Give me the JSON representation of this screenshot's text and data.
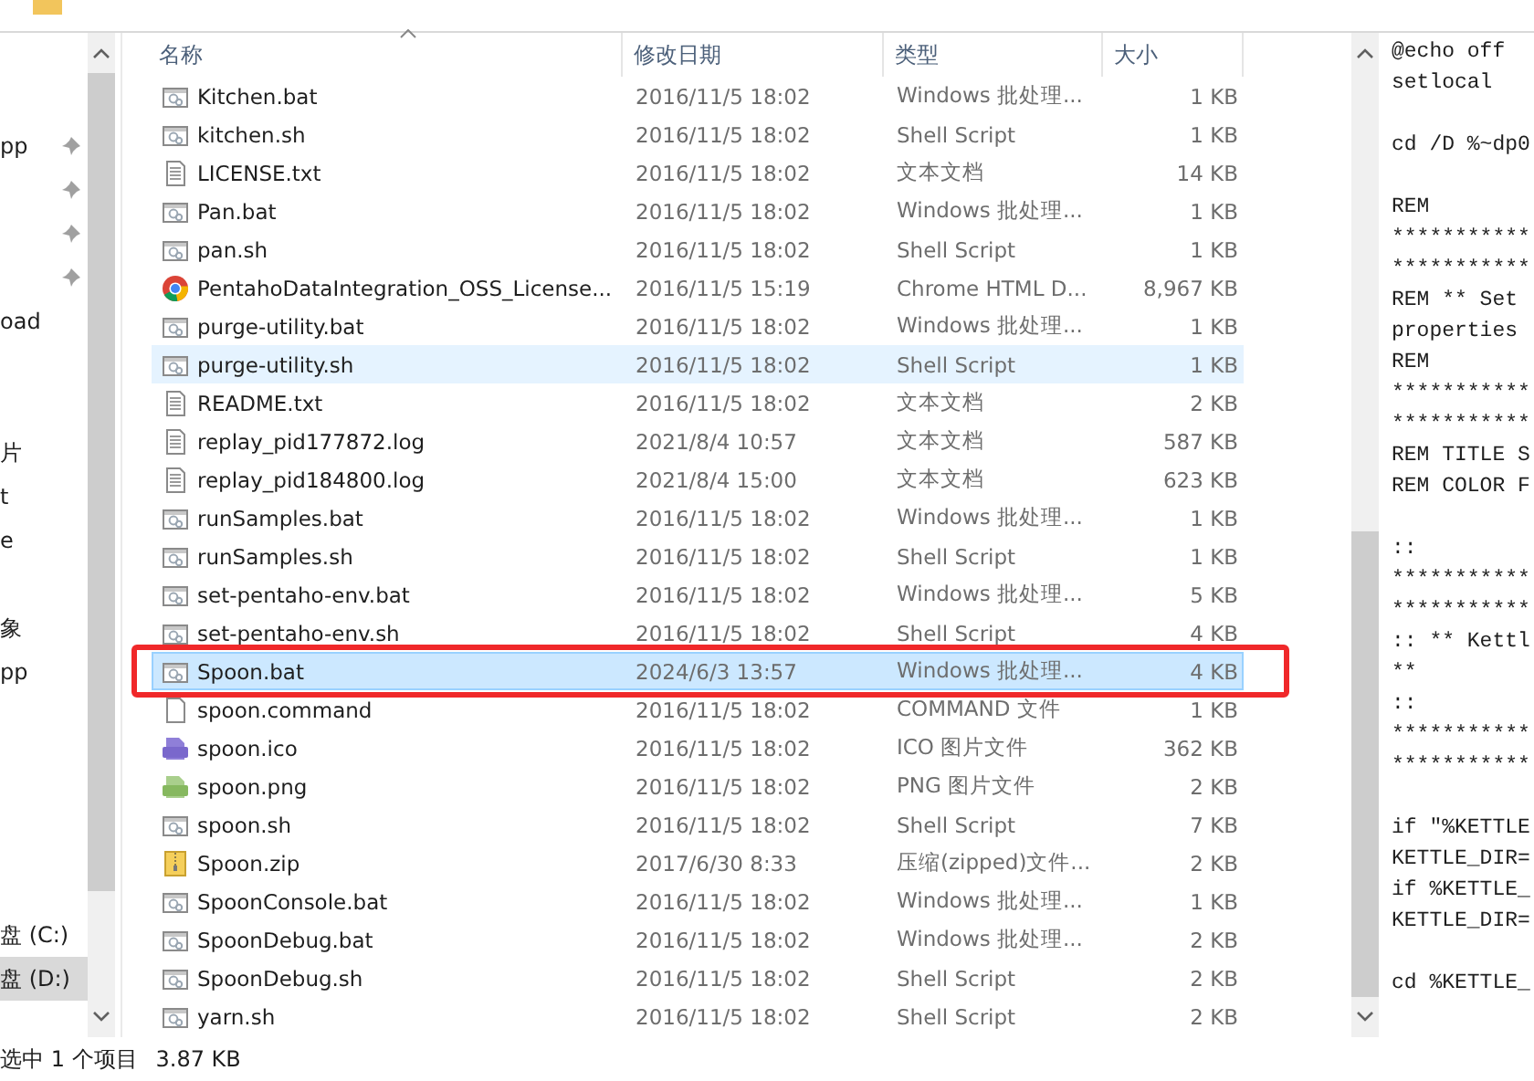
{
  "navigation": {
    "groups": [
      [
        {
          "label": "pp",
          "pinned": true,
          "selected": false
        },
        {
          "pinned": true,
          "selected": false
        },
        {
          "pinned": true,
          "selected": false
        },
        {
          "pinned": true,
          "selected": false
        },
        {
          "label": "oad",
          "pinned": false,
          "selected": false
        }
      ],
      [
        {
          "label": "片",
          "pinned": false,
          "selected": false
        },
        {
          "label": "t",
          "pinned": false,
          "selected": false
        },
        {
          "label": "e",
          "pinned": false,
          "selected": false
        }
      ],
      [
        {
          "label": "象",
          "pinned": false,
          "selected": false
        },
        {
          "label": "pp",
          "pinned": false,
          "selected": false
        }
      ],
      [
        {
          "label": "盘 (C:)",
          "pinned": false,
          "selected": false
        },
        {
          "label": "盘 (D:)",
          "pinned": false,
          "selected": true
        }
      ]
    ]
  },
  "file_list": {
    "columns": [
      "名称",
      "修改日期",
      "类型",
      "大小"
    ],
    "rows": [
      {
        "kind": "script",
        "name": "Kitchen.bat",
        "date": "2016/11/5 18:02",
        "type": "Windows 批处理...",
        "size": "1 KB",
        "selected": false,
        "hovered": false,
        "marked": false
      },
      {
        "kind": "script",
        "name": "kitchen.sh",
        "date": "2016/11/5 18:02",
        "type": "Shell Script",
        "size": "1 KB",
        "selected": false,
        "hovered": false,
        "marked": false
      },
      {
        "kind": "text",
        "name": "LICENSE.txt",
        "date": "2016/11/5 18:02",
        "type": "文本文档",
        "size": "14 KB",
        "selected": false,
        "hovered": false,
        "marked": false
      },
      {
        "kind": "script",
        "name": "Pan.bat",
        "date": "2016/11/5 18:02",
        "type": "Windows 批处理...",
        "size": "1 KB",
        "selected": false,
        "hovered": false,
        "marked": false
      },
      {
        "kind": "script",
        "name": "pan.sh",
        "date": "2016/11/5 18:02",
        "type": "Shell Script",
        "size": "1 KB",
        "selected": false,
        "hovered": false,
        "marked": false
      },
      {
        "kind": "chrome",
        "name": "PentahoDataIntegration_OSS_License...",
        "date": "2016/11/5 15:19",
        "type": "Chrome HTML D...",
        "size": "8,967 KB",
        "selected": false,
        "hovered": false,
        "marked": false
      },
      {
        "kind": "script",
        "name": "purge-utility.bat",
        "date": "2016/11/5 18:02",
        "type": "Windows 批处理...",
        "size": "1 KB",
        "selected": false,
        "hovered": false,
        "marked": false
      },
      {
        "kind": "script",
        "name": "purge-utility.sh",
        "date": "2016/11/5 18:02",
        "type": "Shell Script",
        "size": "1 KB",
        "selected": false,
        "hovered": true,
        "marked": false
      },
      {
        "kind": "text",
        "name": "README.txt",
        "date": "2016/11/5 18:02",
        "type": "文本文档",
        "size": "2 KB",
        "selected": false,
        "hovered": false,
        "marked": false
      },
      {
        "kind": "text",
        "name": "replay_pid177872.log",
        "date": "2021/8/4 10:57",
        "type": "文本文档",
        "size": "587 KB",
        "selected": false,
        "hovered": false,
        "marked": false
      },
      {
        "kind": "text",
        "name": "replay_pid184800.log",
        "date": "2021/8/4 15:00",
        "type": "文本文档",
        "size": "623 KB",
        "selected": false,
        "hovered": false,
        "marked": false
      },
      {
        "kind": "script",
        "name": "runSamples.bat",
        "date": "2016/11/5 18:02",
        "type": "Windows 批处理...",
        "size": "1 KB",
        "selected": false,
        "hovered": false,
        "marked": false
      },
      {
        "kind": "script",
        "name": "runSamples.sh",
        "date": "2016/11/5 18:02",
        "type": "Shell Script",
        "size": "1 KB",
        "selected": false,
        "hovered": false,
        "marked": false
      },
      {
        "kind": "script",
        "name": "set-pentaho-env.bat",
        "date": "2016/11/5 18:02",
        "type": "Windows 批处理...",
        "size": "5 KB",
        "selected": false,
        "hovered": false,
        "marked": false
      },
      {
        "kind": "script",
        "name": "set-pentaho-env.sh",
        "date": "2016/11/5 18:02",
        "type": "Shell Script",
        "size": "4 KB",
        "selected": false,
        "hovered": false,
        "marked": false
      },
      {
        "kind": "script",
        "name": "Spoon.bat",
        "date": "2024/6/3 13:57",
        "type": "Windows 批处理...",
        "size": "4 KB",
        "selected": true,
        "hovered": false,
        "marked": true
      },
      {
        "kind": "blank",
        "name": "spoon.command",
        "date": "2016/11/5 18:02",
        "type": "COMMAND 文件",
        "size": "1 KB",
        "selected": false,
        "hovered": false,
        "marked": false
      },
      {
        "kind": "ico",
        "name": "spoon.ico",
        "date": "2016/11/5 18:02",
        "type": "ICO 图片文件",
        "size": "362 KB",
        "selected": false,
        "hovered": false,
        "marked": false
      },
      {
        "kind": "png",
        "name": "spoon.png",
        "date": "2016/11/5 18:02",
        "type": "PNG 图片文件",
        "size": "2 KB",
        "selected": false,
        "hovered": false,
        "marked": false
      },
      {
        "kind": "script",
        "name": "spoon.sh",
        "date": "2016/11/5 18:02",
        "type": "Shell Script",
        "size": "7 KB",
        "selected": false,
        "hovered": false,
        "marked": false
      },
      {
        "kind": "zip",
        "name": "Spoon.zip",
        "date": "2017/6/30 8:33",
        "type": "压缩(zipped)文件...",
        "size": "2 KB",
        "selected": false,
        "hovered": false,
        "marked": false
      },
      {
        "kind": "script",
        "name": "SpoonConsole.bat",
        "date": "2016/11/5 18:02",
        "type": "Windows 批处理...",
        "size": "1 KB",
        "selected": false,
        "hovered": false,
        "marked": false
      },
      {
        "kind": "script",
        "name": "SpoonDebug.bat",
        "date": "2016/11/5 18:02",
        "type": "Windows 批处理...",
        "size": "2 KB",
        "selected": false,
        "hovered": false,
        "marked": false
      },
      {
        "kind": "script",
        "name": "SpoonDebug.sh",
        "date": "2016/11/5 18:02",
        "type": "Shell Script",
        "size": "2 KB",
        "selected": false,
        "hovered": false,
        "marked": false
      },
      {
        "kind": "script",
        "name": "yarn.sh",
        "date": "2016/11/5 18:02",
        "type": "Shell Script",
        "size": "2 KB",
        "selected": false,
        "hovered": false,
        "marked": false
      }
    ]
  },
  "preview": {
    "blocks": [
      [
        "@echo off",
        "setlocal"
      ],
      [
        "cd /D %~dp0"
      ],
      [
        "REM",
        "***********",
        "***********",
        "REM ** Set",
        "properties",
        "REM",
        "***********",
        "***********",
        "REM TITLE S",
        "REM COLOR F"
      ],
      [
        "::",
        "***********",
        "***********",
        ":: ** Kettl",
        "**",
        "::",
        "***********",
        "***********"
      ],
      [
        "if \"%KETTLE",
        "KETTLE_DIR=",
        "if %KETTLE_",
        "KETTLE_DIR="
      ],
      [
        "cd %KETTLE_"
      ]
    ]
  },
  "status_bar": {
    "selection": "选中 1 个项目",
    "size": "3.87 KB"
  }
}
